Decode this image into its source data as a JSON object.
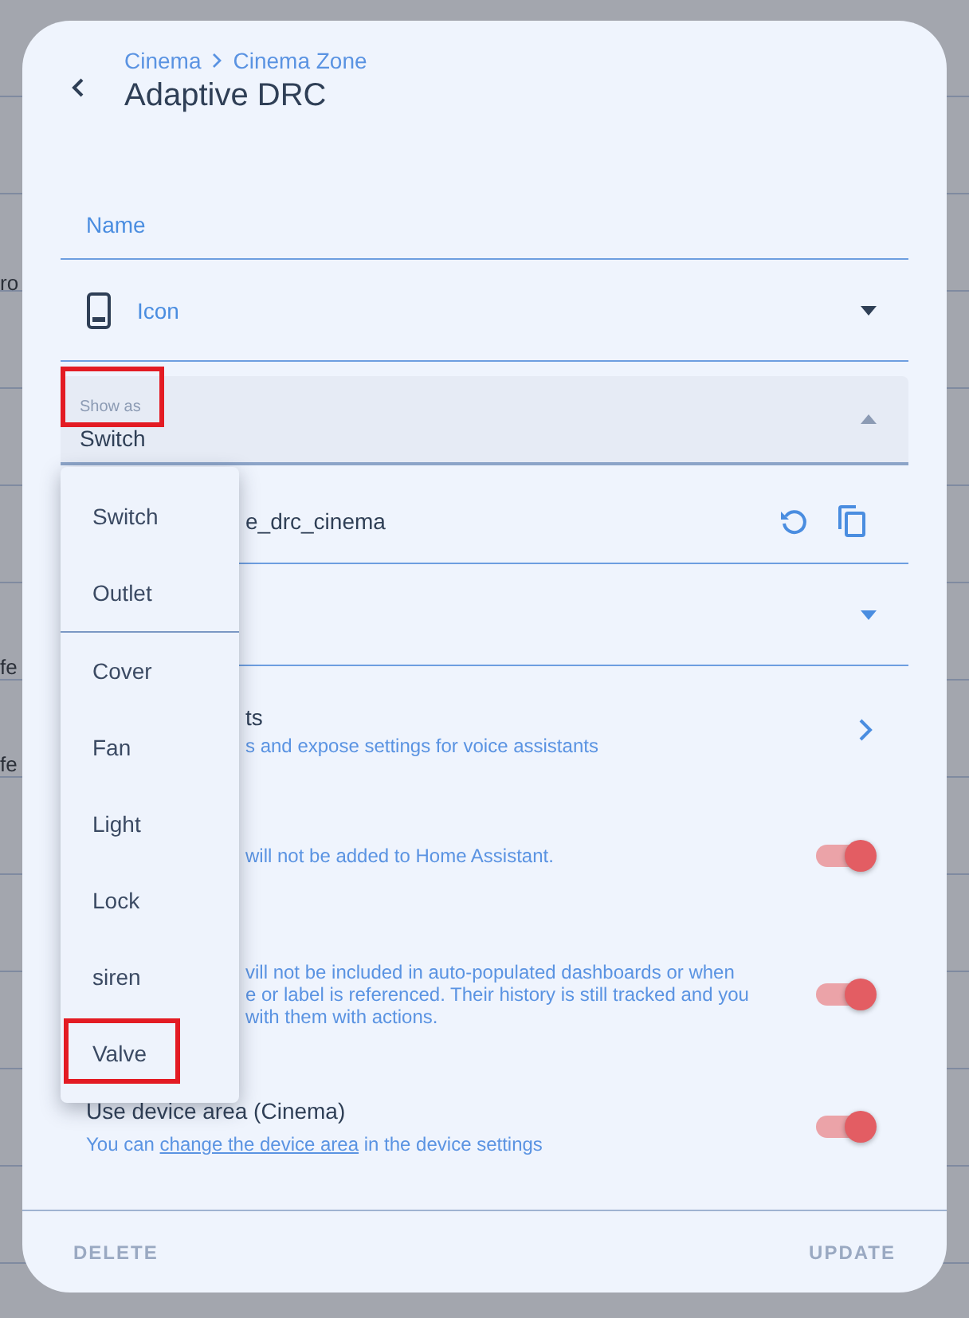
{
  "backdrop": {
    "fragments": [
      "ro",
      "fe",
      "fe"
    ]
  },
  "header": {
    "breadcrumb": [
      "Cinema",
      "Cinema Zone"
    ],
    "title": "Adaptive DRC"
  },
  "fields": [
    {
      "kind": "text",
      "label": "Name"
    },
    {
      "kind": "icon_picker",
      "label": "Icon",
      "expanded": false
    },
    {
      "kind": "select",
      "label": "Show as",
      "value": "Switch",
      "expanded": true,
      "highlighted": true
    },
    {
      "kind": "entity_id",
      "value": "e_drc_cinema"
    },
    {
      "kind": "select_empty",
      "expanded": false
    }
  ],
  "settings": [
    {
      "kind": "link",
      "title": "ts",
      "lines": [
        "s and expose settings for voice assistants"
      ]
    },
    {
      "kind": "toggle",
      "lines": [
        " will not be added to Home Assistant."
      ],
      "on": true
    },
    {
      "kind": "toggle",
      "lines": [
        "vill not be included in auto-populated dashboards or when",
        "e or label is referenced. Their history is still tracked and you",
        "with them with actions."
      ],
      "on": true
    },
    {
      "kind": "toggle",
      "title": "Use device area (Cinema)",
      "before": "You can ",
      "link": "change the device area",
      "after": " in the device settings",
      "on": true
    }
  ],
  "menu": {
    "groups": [
      [
        {
          "label": "Switch",
          "highlighted": false
        },
        {
          "label": "Outlet",
          "highlighted": false
        }
      ],
      [
        {
          "label": "Cover",
          "highlighted": false
        },
        {
          "label": "Fan",
          "highlighted": false
        },
        {
          "label": "Light",
          "highlighted": false
        },
        {
          "label": "Lock",
          "highlighted": false
        },
        {
          "label": "siren",
          "highlighted": false
        },
        {
          "label": "Valve",
          "highlighted": true
        }
      ]
    ]
  },
  "footer": {
    "buttons": [
      "DELETE",
      "UPDATE"
    ]
  }
}
